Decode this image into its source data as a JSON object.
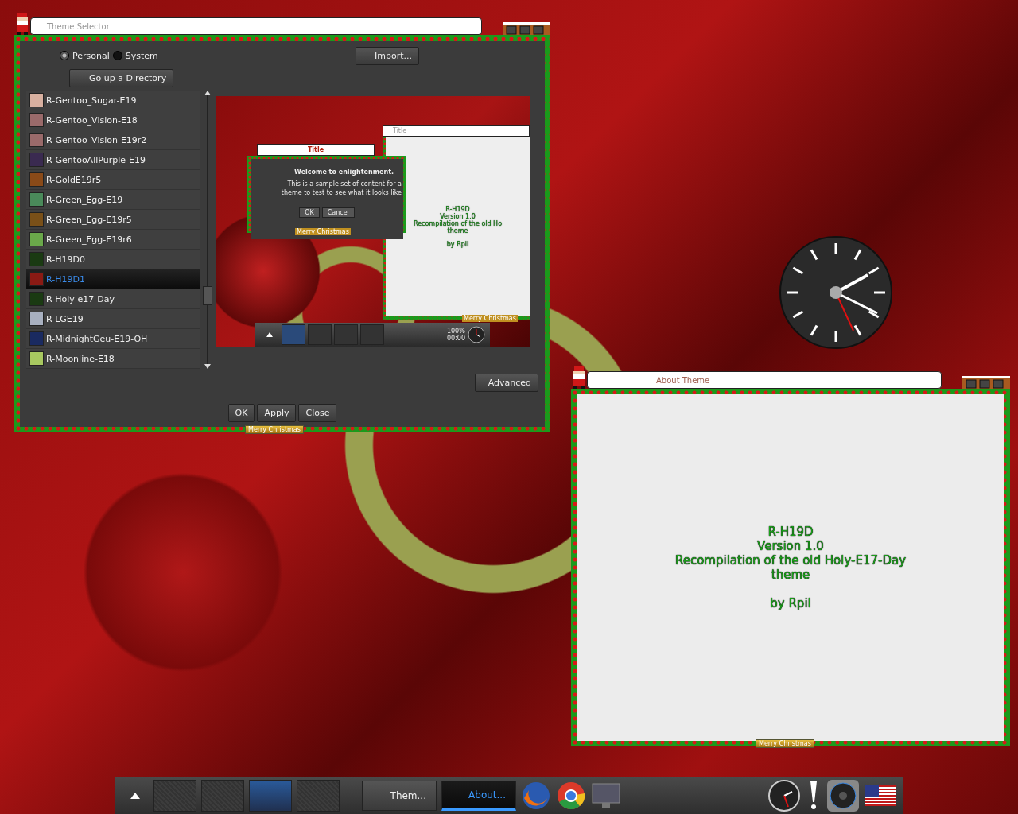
{
  "theme_selector": {
    "title": "Theme Selector",
    "source_options": [
      {
        "label": "Personal",
        "selected": true
      },
      {
        "label": "System",
        "selected": false
      }
    ],
    "import_button": "Import...",
    "up_button": "Go up a Directory",
    "themes": [
      {
        "name": "R-Gentoo_Sugar-E19",
        "color": "#d8b0a0",
        "selected": false
      },
      {
        "name": "R-Gentoo_Vision-E18",
        "color": "#9a6a6a",
        "selected": false
      },
      {
        "name": "R-Gentoo_Vision-E19r2",
        "color": "#9a6a6a",
        "selected": false
      },
      {
        "name": "R-GentooAllPurple-E19",
        "color": "#3a2a50",
        "selected": false
      },
      {
        "name": "R-GoldE19r5",
        "color": "#8a4a18",
        "selected": false
      },
      {
        "name": "R-Green_Egg-E19",
        "color": "#4a8a5a",
        "selected": false
      },
      {
        "name": "R-Green_Egg-E19r5",
        "color": "#7a5018",
        "selected": false
      },
      {
        "name": "R-Green_Egg-E19r6",
        "color": "#6aa84a",
        "selected": false
      },
      {
        "name": "R-H19D0",
        "color": "#1a3a12",
        "selected": false
      },
      {
        "name": "R-H19D1",
        "color": "#8a1a14",
        "selected": true
      },
      {
        "name": "R-Holy-e17-Day",
        "color": "#1a3a12",
        "selected": false
      },
      {
        "name": "R-LGE19",
        "color": "#a8b0c0",
        "selected": false
      },
      {
        "name": "R-MidnightGeu-E19-OH",
        "color": "#1a2a60",
        "selected": false
      },
      {
        "name": "R-Moonline-E18",
        "color": "#a8c860",
        "selected": false
      }
    ],
    "preview": {
      "dialog_title": "Title",
      "heading": "Welcome to enlightenment.",
      "body": [
        "This is a sample set of content for a",
        "theme to test to see what it looks like"
      ],
      "buttons": [
        "OK",
        "Cancel"
      ],
      "dialog_banner": "Merry Christmas",
      "window_title": "Title",
      "window_lines": [
        "R-H19D",
        "Version 1.0",
        "Recompilation of the old Ho",
        "theme"
      ],
      "window_author": "by Rpil",
      "window_banner": "Merry Christmas",
      "shelf_readings": [
        "100%",
        "00:00"
      ]
    },
    "advanced_button": "Advanced",
    "buttons": [
      "OK",
      "Apply",
      "Close"
    ],
    "banner": "Merry Christmas"
  },
  "about_theme": {
    "title": "About Theme",
    "lines": [
      "R-H19D",
      "Version 1.0",
      "Recompilation of the old Holy-E17-Day",
      "theme"
    ],
    "author": "by Rpil",
    "banner": "Merry Christmas"
  },
  "shelf": {
    "desks": [
      {
        "selected": false
      },
      {
        "selected": false
      },
      {
        "selected": true
      },
      {
        "selected": false
      }
    ],
    "tasks": [
      {
        "label": "Them...",
        "selected": false
      },
      {
        "label": "About...",
        "selected": true
      }
    ]
  }
}
